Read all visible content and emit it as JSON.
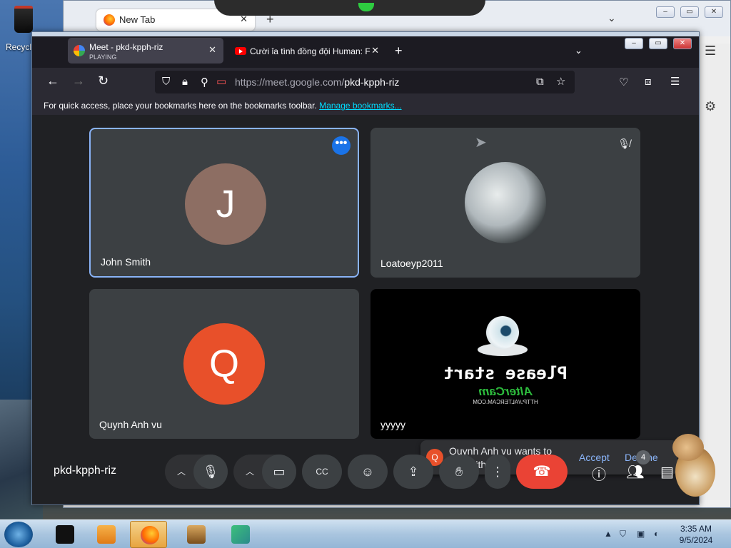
{
  "desktop": {
    "recycle_label": "Recycl"
  },
  "back_window": {
    "tab_title": "New Tab",
    "tab_close": "✕",
    "new_tab": "+",
    "tabs_menu": "⌄"
  },
  "tabs": [
    {
      "title": "Meet - pkd-kpph-riz",
      "status": "PLAYING"
    },
    {
      "title": "Cười ỉa tình đồng đội Human: F"
    }
  ],
  "tab_close": "✕",
  "new_tab": "+",
  "tabs_menu": "⌄",
  "url": {
    "host": "https://meet.google.com/",
    "path": "pkd-kpph-riz"
  },
  "bookmarks_bar": {
    "text": "For quick access, place your bookmarks here on the bookmarks toolbar.",
    "link": "Manage bookmarks..."
  },
  "participants": [
    {
      "name": "John Smith",
      "initial": "J",
      "color": "#8d6e63"
    },
    {
      "name": "Loatoeyp2011"
    },
    {
      "name": "Quynh Anh vu",
      "initial": "Q",
      "color": "#e8502a"
    },
    {
      "name": "yyyyy"
    }
  ],
  "altercam": {
    "line1": "Please start",
    "line2": "AlterCam",
    "line3": "HTTP://ALTERCAM.COM"
  },
  "pair_request": {
    "initial": "Q",
    "message": "Quynh Anh vu wants to pair with you",
    "accept": "Accept",
    "decline": "Decline"
  },
  "meeting_code": "pkd-kpph-riz",
  "controls": {
    "more": "⋮",
    "people_count": "4"
  },
  "clock": {
    "time": "3:35 AM",
    "date": "9/5/2024"
  }
}
